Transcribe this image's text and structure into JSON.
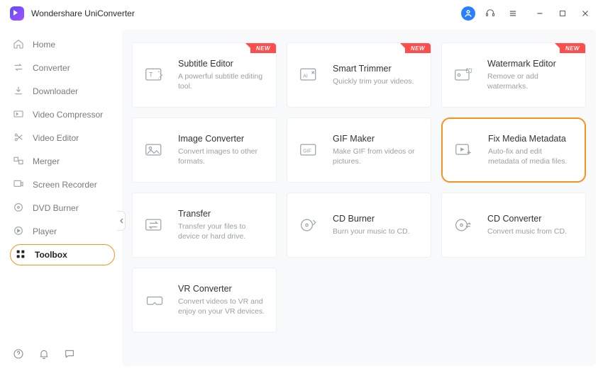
{
  "header": {
    "title": "Wondershare UniConverter"
  },
  "badges": {
    "new": "NEW"
  },
  "sidebar": {
    "items": [
      {
        "label": "Home"
      },
      {
        "label": "Converter"
      },
      {
        "label": "Downloader"
      },
      {
        "label": "Video Compressor"
      },
      {
        "label": "Video Editor"
      },
      {
        "label": "Merger"
      },
      {
        "label": "Screen Recorder"
      },
      {
        "label": "DVD Burner"
      },
      {
        "label": "Player"
      },
      {
        "label": "Toolbox"
      }
    ],
    "active_index": 9
  },
  "tools": [
    {
      "title": "Subtitle Editor",
      "desc": "A powerful subtitle editing tool.",
      "new": true
    },
    {
      "title": "Smart Trimmer",
      "desc": "Quickly trim your videos.",
      "new": true
    },
    {
      "title": "Watermark Editor",
      "desc": "Remove or add watermarks.",
      "new": true
    },
    {
      "title": "Image Converter",
      "desc": "Convert images to other formats.",
      "new": false
    },
    {
      "title": "GIF Maker",
      "desc": "Make GIF from videos or pictures.",
      "new": false
    },
    {
      "title": "Fix Media Metadata",
      "desc": "Auto-fix and edit metadata of media files.",
      "new": false,
      "highlighted": true
    },
    {
      "title": "Transfer",
      "desc": "Transfer your files to device or hard drive.",
      "new": false
    },
    {
      "title": "CD Burner",
      "desc": "Burn your music to CD.",
      "new": false
    },
    {
      "title": "CD Converter",
      "desc": "Convert music from CD.",
      "new": false
    },
    {
      "title": "VR Converter",
      "desc": "Convert videos to VR and enjoy on your VR devices.",
      "new": false
    }
  ],
  "colors": {
    "accent": "#f4931e",
    "badge": "#ff4d4d",
    "account": "#2a7fff"
  }
}
